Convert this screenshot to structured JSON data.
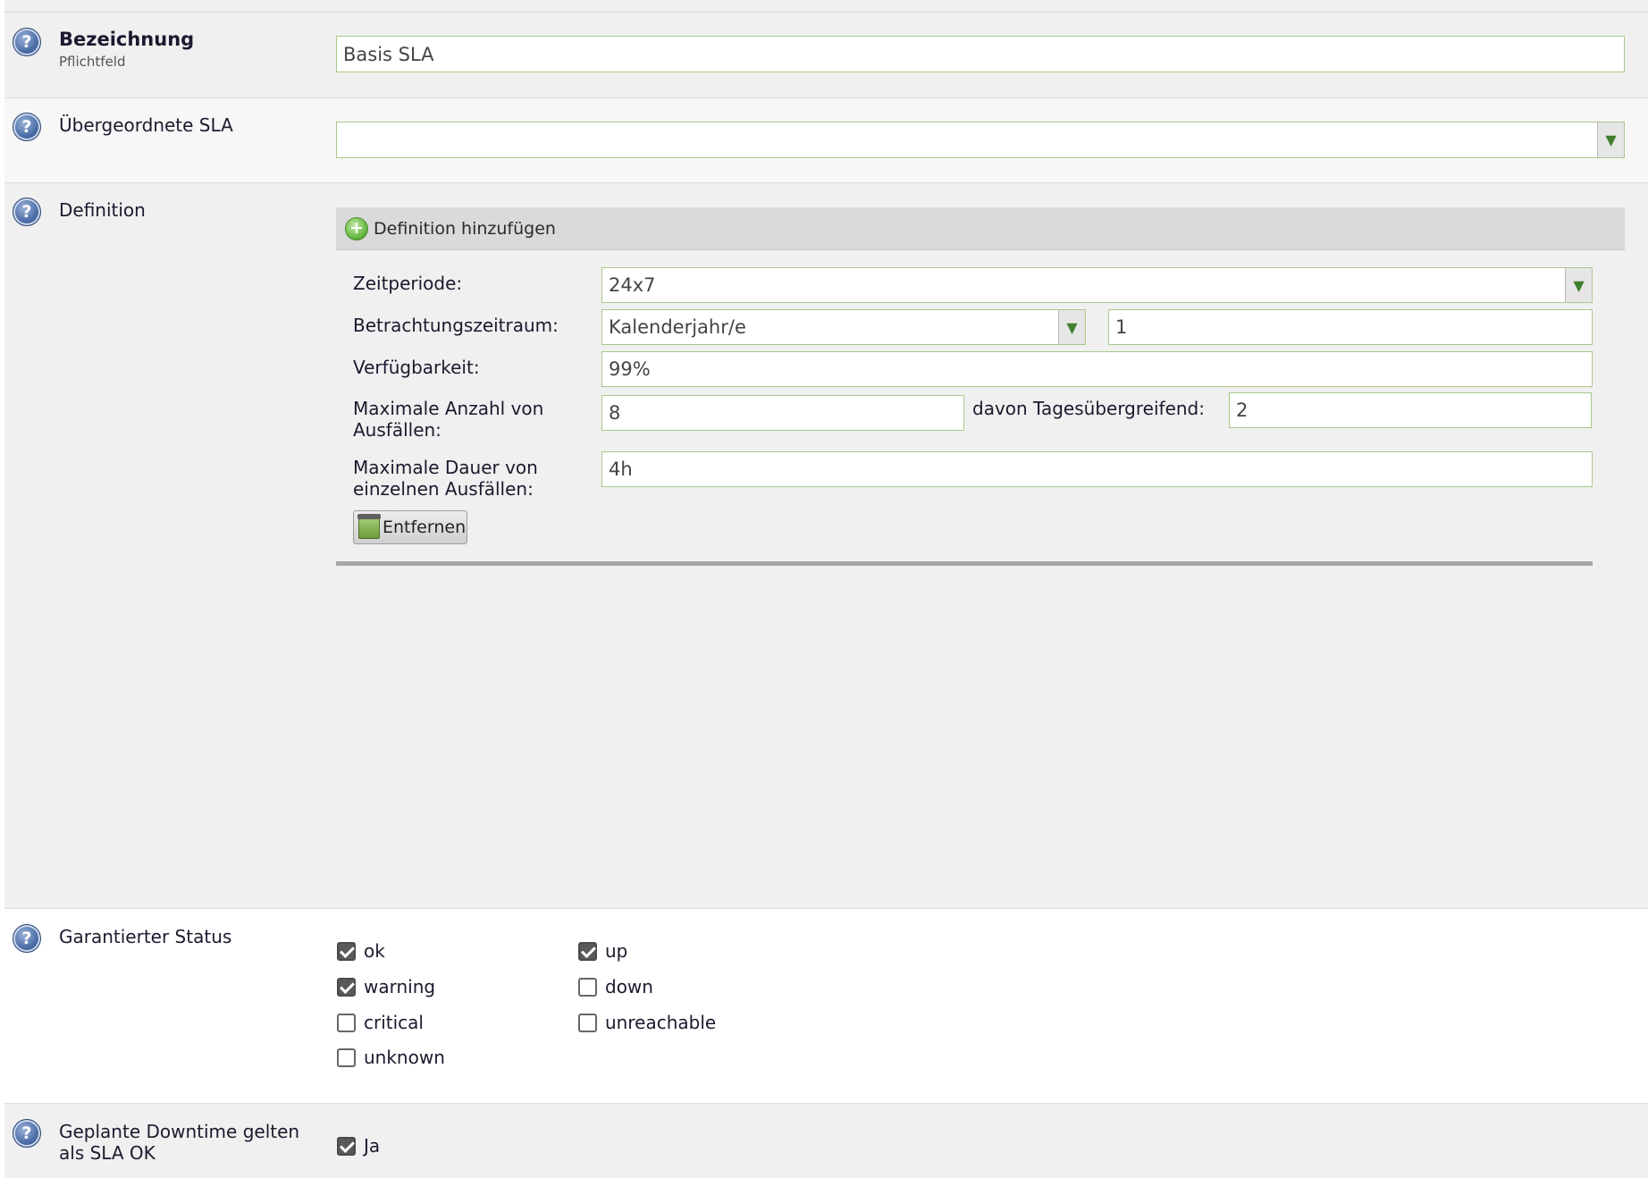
{
  "name_field": {
    "label": "Bezeichnung",
    "sublabel": "Pflichtfeld",
    "value": "Basis SLA"
  },
  "parent_sla": {
    "label": "Übergeordnete SLA",
    "value": ""
  },
  "definition": {
    "label": "Definition",
    "add_label": "Definition hinzufügen",
    "zeitperiode": {
      "label": "Zeitperiode:",
      "value": "24x7"
    },
    "betrachtung": {
      "label": "Betrachtungszeitraum:",
      "value": "Kalenderjahr/e",
      "count": "1"
    },
    "verfuegbarkeit": {
      "label": "Verfügbarkeit:",
      "value": "99%"
    },
    "max_anzahl": {
      "label_line1": "Maximale Anzahl von",
      "label_line2": "Ausfällen:",
      "value": "8",
      "davon_label": "davon Tagesübergreifend:",
      "davon_value": "2"
    },
    "max_dauer": {
      "label_line1": "Maximale Dauer von",
      "label_line2": "einzelnen Ausfällen:",
      "value": "4h"
    },
    "remove_label": "Entfernen"
  },
  "status": {
    "label": "Garantierter Status",
    "service": [
      {
        "label": "ok",
        "checked": true
      },
      {
        "label": "warning",
        "checked": true
      },
      {
        "label": "critical",
        "checked": false
      },
      {
        "label": "unknown",
        "checked": false
      }
    ],
    "host": [
      {
        "label": "up",
        "checked": true
      },
      {
        "label": "down",
        "checked": false
      },
      {
        "label": "unreachable",
        "checked": false
      }
    ]
  },
  "downtime": {
    "label_line1": "Geplante Downtime gelten",
    "label_line2": "als SLA OK",
    "option": "Ja",
    "checked": true
  },
  "colors": {
    "field_border": "#a9c98a",
    "dropdown_arrow": "#3f7f2d",
    "help_icon": "#4d6fa8"
  }
}
